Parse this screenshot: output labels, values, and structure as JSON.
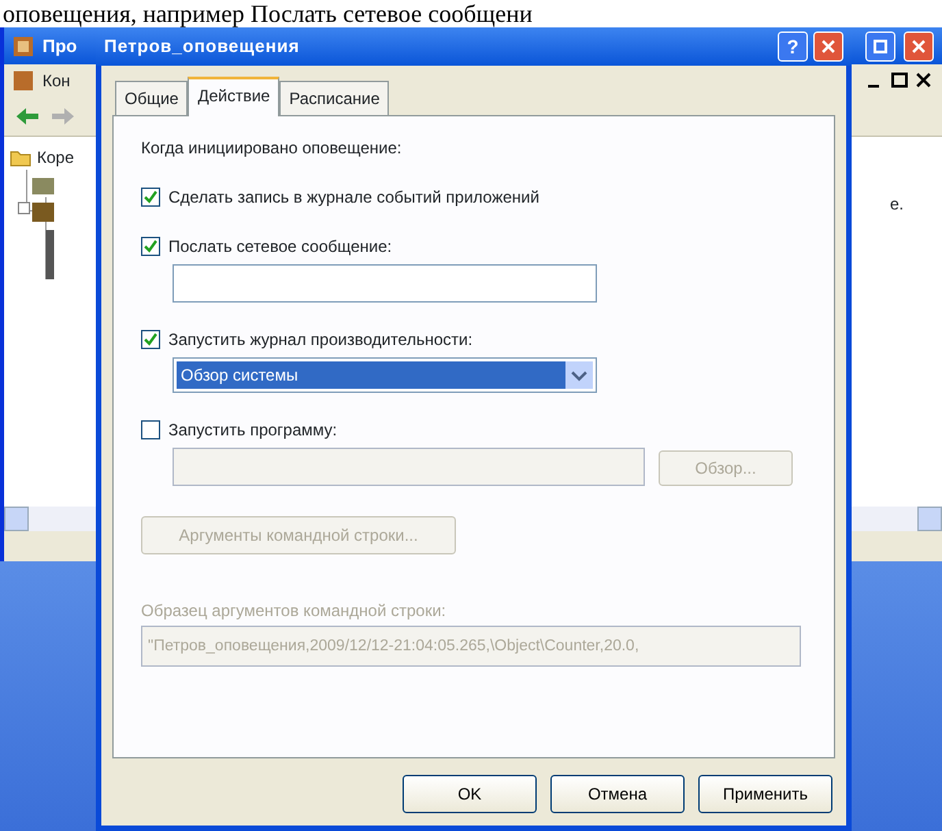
{
  "document_text": "оповещения, например Послать сетевое сообщени",
  "background_window": {
    "title": "Про",
    "menu_item": "Кон",
    "tree_items": [
      "Коре"
    ],
    "content_text": "е."
  },
  "dialog": {
    "title": "Петров_оповещения",
    "help_label": "?",
    "tabs": [
      {
        "label": "Общие",
        "selected": false
      },
      {
        "label": "Действие",
        "selected": true
      },
      {
        "label": "Расписание",
        "selected": false
      }
    ],
    "heading": "Когда инициировано оповещение:",
    "options": [
      {
        "kind": "checkbox",
        "label": "Сделать запись в журнале событий приложений",
        "checked": true
      },
      {
        "kind": "checkbox_text",
        "label": "Послать сетевое сообщение:",
        "checked": true
      },
      {
        "kind": "checkbox_select",
        "label": "Запустить журнал производительности:",
        "checked": true,
        "value": "Обзор системы"
      },
      {
        "kind": "checkbox_browse",
        "label": "Запустить программу:",
        "checked": false,
        "button": "Обзор..."
      }
    ],
    "args_button": {
      "label": "Аргументы командной строки...",
      "disabled": true
    },
    "sample_label": "Образец аргументов командной строки:",
    "sample_value": "\"Петров_оповещения,2009/12/12-21:04:05.265,\\Object\\Counter,20.0,",
    "buttons": [
      "OK",
      "Отмена",
      "Применить"
    ]
  }
}
